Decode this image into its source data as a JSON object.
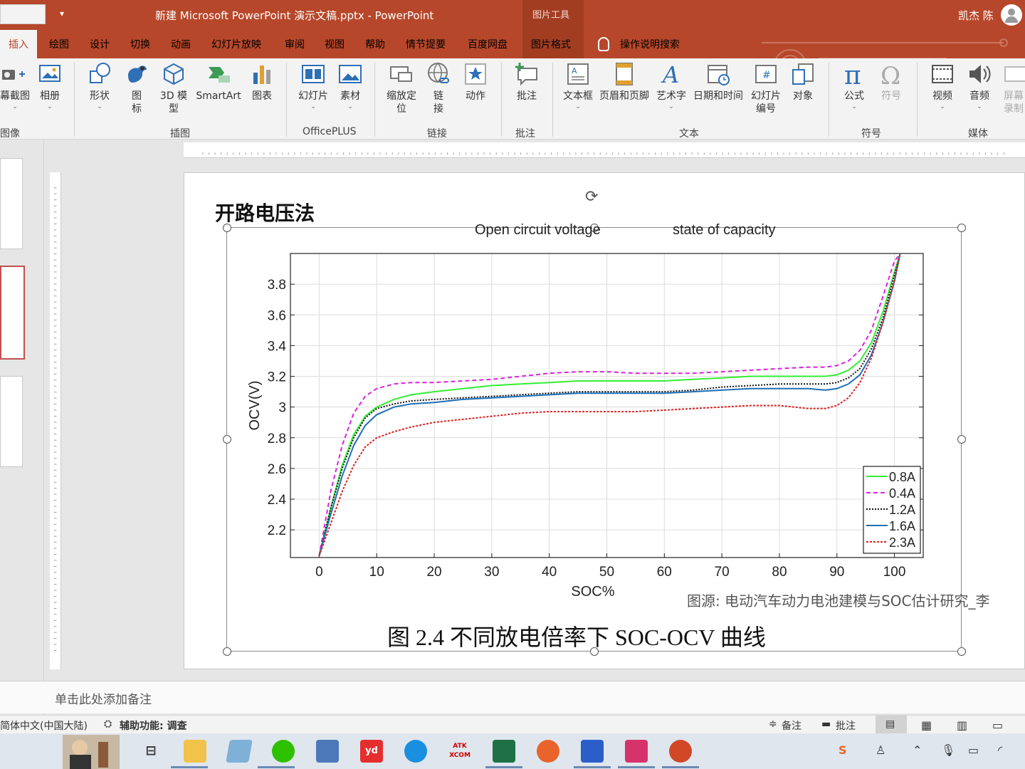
{
  "titlebar": {
    "title": "新建 Microsoft PowerPoint 演示文稿.pptx  -  PowerPoint",
    "context_tab": "图片工具",
    "user": "凯杰 陈"
  },
  "tabs": [
    "插入",
    "绘图",
    "设计",
    "切换",
    "动画",
    "幻灯片放映",
    "审阅",
    "视图",
    "帮助",
    "情节提要",
    "百度网盘",
    "图片格式"
  ],
  "search_label": "操作说明搜索",
  "ribbon": {
    "buttons": {
      "screenshot": "幕截图",
      "album": "相册",
      "shapes": "形状",
      "icons_l1": "图",
      "icons_l2": "标",
      "model3d_l1": "3D 模",
      "model3d_l2": "型",
      "smartart": "SmartArt",
      "chart": "图表",
      "slide_l1": "幻灯片",
      "material": "素材",
      "zoom_l1": "缩放定",
      "zoom_l2": "位",
      "link_l1": "链",
      "link_l2": "接",
      "action": "动作",
      "comment": "批注",
      "textbox": "文本框",
      "header_footer": "页眉和页脚",
      "wordart": "艺术字",
      "datetime": "日期和时间",
      "slidenum_l1": "幻灯片",
      "slidenum_l2": "编号",
      "object": "对象",
      "equation": "公式",
      "symbol": "符号",
      "video": "视频",
      "audio": "音频",
      "screenrec_l1": "屏幕",
      "screenrec_l2": "录制"
    },
    "groups": {
      "images": "图像",
      "illustrations": "插图",
      "officeplus": "OfficePLUS",
      "links": "链接",
      "comments": "批注",
      "text": "文本",
      "symbols": "符号",
      "media": "媒体"
    }
  },
  "slide": {
    "title": "开路电压法",
    "annotation_left": "Open circuit voltage",
    "annotation_right": "state of capacity",
    "source": "图源: 电动汽车动力电池建模与SOC估计研究_李",
    "caption": "图 2.4  不同放电倍率下 SOC-OCV 曲线"
  },
  "chart_data": {
    "type": "line",
    "xlabel": "SOC%",
    "ylabel": "OCV(V)",
    "xlim": [
      -5,
      105
    ],
    "ylim": [
      2.02,
      4.0
    ],
    "xticks": [
      0,
      10,
      20,
      30,
      40,
      50,
      60,
      70,
      80,
      90,
      100
    ],
    "yticks": [
      2.2,
      2.4,
      2.6,
      2.8,
      3.0,
      3.2,
      3.4,
      3.6,
      3.8
    ],
    "ytick_labels": [
      "2.2",
      "2.4",
      "2.6",
      "2.8",
      "3",
      "3.2",
      "3.4",
      "3.6",
      "3.8"
    ],
    "grid": true,
    "legend_position": "bottom-right",
    "x": [
      0,
      2,
      4,
      6,
      8,
      10,
      13,
      16,
      20,
      25,
      30,
      35,
      40,
      45,
      50,
      55,
      60,
      65,
      70,
      75,
      80,
      85,
      88,
      90,
      92,
      94,
      96,
      98,
      100,
      101
    ],
    "series": [
      {
        "name": "0.8A",
        "color": "#33ee33",
        "dash": "",
        "values": [
          2.03,
          2.34,
          2.62,
          2.82,
          2.94,
          3.0,
          3.05,
          3.08,
          3.1,
          3.12,
          3.14,
          3.15,
          3.16,
          3.17,
          3.17,
          3.17,
          3.17,
          3.18,
          3.19,
          3.2,
          3.2,
          3.2,
          3.2,
          3.21,
          3.24,
          3.3,
          3.42,
          3.62,
          3.88,
          4.0
        ]
      },
      {
        "name": "0.4A",
        "color": "#dd22dd",
        "dash": "6,4",
        "values": [
          2.03,
          2.45,
          2.75,
          2.96,
          3.07,
          3.12,
          3.15,
          3.16,
          3.16,
          3.17,
          3.18,
          3.2,
          3.22,
          3.23,
          3.23,
          3.22,
          3.22,
          3.22,
          3.23,
          3.24,
          3.25,
          3.26,
          3.26,
          3.27,
          3.3,
          3.37,
          3.5,
          3.72,
          3.95,
          4.0
        ]
      },
      {
        "name": "1.2A",
        "color": "#111111",
        "dash": "2,2",
        "values": [
          2.03,
          2.34,
          2.6,
          2.8,
          2.93,
          2.99,
          3.02,
          3.04,
          3.05,
          3.06,
          3.07,
          3.08,
          3.09,
          3.1,
          3.1,
          3.1,
          3.1,
          3.11,
          3.13,
          3.14,
          3.15,
          3.15,
          3.15,
          3.16,
          3.19,
          3.25,
          3.38,
          3.58,
          3.86,
          4.0
        ]
      },
      {
        "name": "1.6A",
        "color": "#1f6fb4",
        "dash": "",
        "values": [
          2.03,
          2.3,
          2.55,
          2.75,
          2.88,
          2.95,
          3.0,
          3.02,
          3.03,
          3.05,
          3.06,
          3.07,
          3.08,
          3.09,
          3.09,
          3.09,
          3.09,
          3.1,
          3.11,
          3.12,
          3.12,
          3.12,
          3.11,
          3.12,
          3.15,
          3.21,
          3.34,
          3.55,
          3.82,
          4.0
        ]
      },
      {
        "name": "2.3A",
        "color": "#dd2222",
        "dash": "3,2",
        "values": [
          2.03,
          2.24,
          2.45,
          2.62,
          2.74,
          2.8,
          2.84,
          2.87,
          2.9,
          2.92,
          2.94,
          2.96,
          2.97,
          2.97,
          2.97,
          2.97,
          2.98,
          2.99,
          3.0,
          3.01,
          3.01,
          2.99,
          2.99,
          3.01,
          3.06,
          3.16,
          3.32,
          3.55,
          3.82,
          4.0
        ]
      }
    ]
  },
  "notes": {
    "placeholder": "单击此处添加备注"
  },
  "status": {
    "language": "简体中文(中国大陆)",
    "accessibility": "辅助功能: 调查",
    "notes_btn": "备注",
    "comments_btn": "批注"
  },
  "taskbar": {
    "youdao": "yd",
    "atk": "ATK XCOM"
  }
}
